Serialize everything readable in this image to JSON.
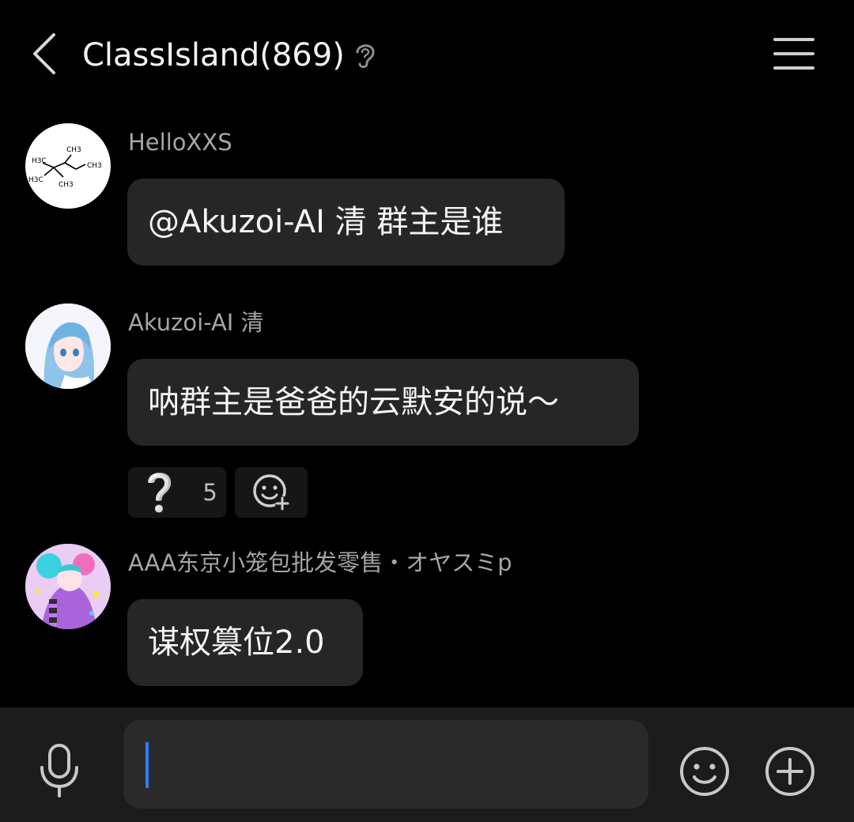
{
  "header": {
    "back_icon": "chevron-left-icon",
    "title": "ClassIsland(869)",
    "ear_icon": "ear-icon",
    "menu_icon": "hamburger-menu-icon"
  },
  "messages": [
    {
      "sender": "HelloXXS",
      "text": "@Akuzoi-AI 清 群主是谁",
      "avatar": {
        "icon": "chemical-structure-avatar",
        "labels": [
          "CH3",
          "H3C",
          "CH3",
          "H3C",
          "CH3"
        ]
      }
    },
    {
      "sender": "Akuzoi-AI 清",
      "text": "呐群主是爸爸的云默安的说～",
      "avatar": {
        "icon": "anime-girl-avatar"
      }
    },
    {
      "sender": "AAA东京小笼包批发零售・オヤスミp",
      "text": "谋权篡位2.0",
      "avatar": {
        "icon": "anime-character-avatar"
      }
    }
  ],
  "reactions": [
    {
      "emoji": "❔",
      "count": "5"
    },
    {
      "icon": "add-reaction-icon"
    }
  ],
  "input": {
    "mic_icon": "microphone-icon",
    "value": "",
    "emoji_icon": "smiley-icon",
    "plus_icon": "plus-circle-icon"
  },
  "colors": {
    "background": "#000000",
    "bubble": "#262626",
    "input_bar": "#1c1c1c",
    "caret": "#2f7cf6"
  }
}
